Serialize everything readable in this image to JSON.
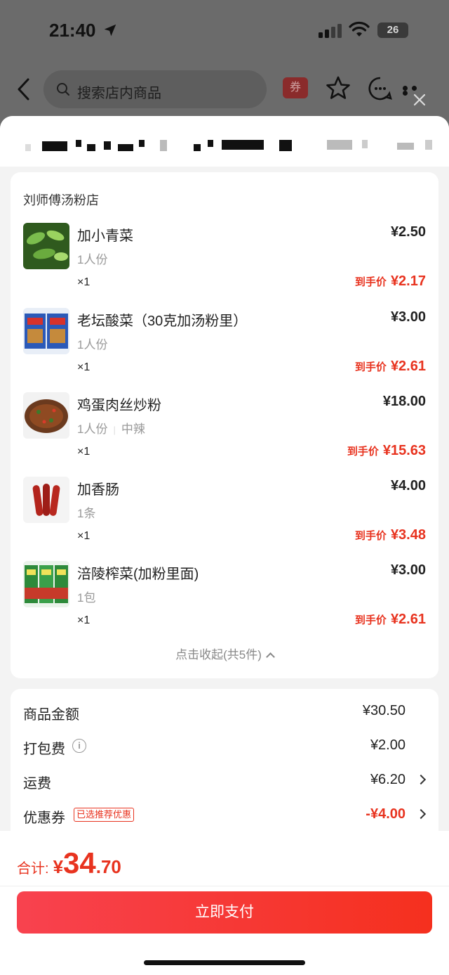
{
  "status": {
    "time": "21:40",
    "battery": "26"
  },
  "nav": {
    "search_placeholder": "搜索店内商品",
    "coupon_label": "券"
  },
  "order": {
    "store_name": "刘师傅汤粉店",
    "final_price_label": "到手价",
    "items": [
      {
        "name": "加小青菜",
        "spec": "1人份",
        "qty": "×1",
        "price": "¥2.50",
        "final": "¥2.17"
      },
      {
        "name": "老坛酸菜（30克加汤粉里）",
        "spec": "1人份",
        "qty": "×1",
        "price": "¥3.00",
        "final": "¥2.61"
      },
      {
        "name": "鸡蛋肉丝炒粉",
        "spec": "1人份",
        "spec2": "中辣",
        "qty": "×1",
        "price": "¥18.00",
        "final": "¥15.63"
      },
      {
        "name": "加香肠",
        "spec": "1条",
        "qty": "×1",
        "price": "¥4.00",
        "final": "¥3.48"
      },
      {
        "name": "涪陵榨菜(加粉里面)",
        "spec": "1包",
        "qty": "×1",
        "price": "¥3.00",
        "final": "¥2.61"
      }
    ],
    "collapse_label": "点击收起(共5件)"
  },
  "fees": {
    "goods": {
      "label": "商品金额",
      "value": "¥30.50"
    },
    "packing": {
      "label": "打包费",
      "value": "¥2.00"
    },
    "delivery": {
      "label": "运费",
      "value": "¥6.20"
    },
    "coupon": {
      "label": "优惠券",
      "tag": "已选推荐优惠",
      "value": "-¥4.00"
    }
  },
  "total": {
    "label": "合计:",
    "currency": "¥",
    "integer": "34",
    "decimal": ".70"
  },
  "pay_button": "立即支付",
  "colors": {
    "accent": "#e8331f",
    "pay_gradient_start": "#f8424f",
    "pay_gradient_end": "#f5301e"
  }
}
